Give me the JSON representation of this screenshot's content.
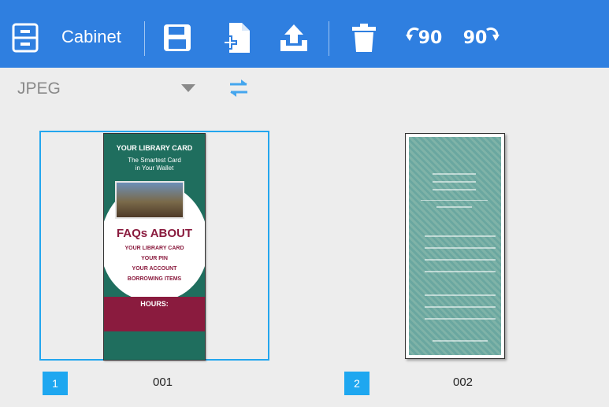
{
  "toolbar": {
    "cabinet_label": "Cabinet",
    "rotate_left_label": "90",
    "rotate_right_label": "90",
    "icons": [
      "cabinet-icon",
      "save-icon",
      "add-page-icon",
      "upload-icon",
      "trash-icon",
      "rotate-left-icon",
      "rotate-right-icon"
    ],
    "accent_color": "#2f7fe0"
  },
  "format": {
    "selected": "JPEG"
  },
  "pages": [
    {
      "index": "1",
      "name": "001",
      "selected": true,
      "preview": {
        "title": "YOUR LIBRARY CARD",
        "subtitle_line1": "The Smartest Card",
        "subtitle_line2": "in Your Wallet",
        "heading": "FAQs ABOUT",
        "items": [
          "YOUR LIBRARY CARD",
          "YOUR PIN",
          "YOUR ACCOUNT",
          "BORROWING ITEMS"
        ],
        "hours": "HOURS:"
      }
    },
    {
      "index": "2",
      "name": "002",
      "selected": false
    }
  ],
  "colors": {
    "selection_border": "#23a6ee",
    "badge": "#1ea7f0"
  }
}
